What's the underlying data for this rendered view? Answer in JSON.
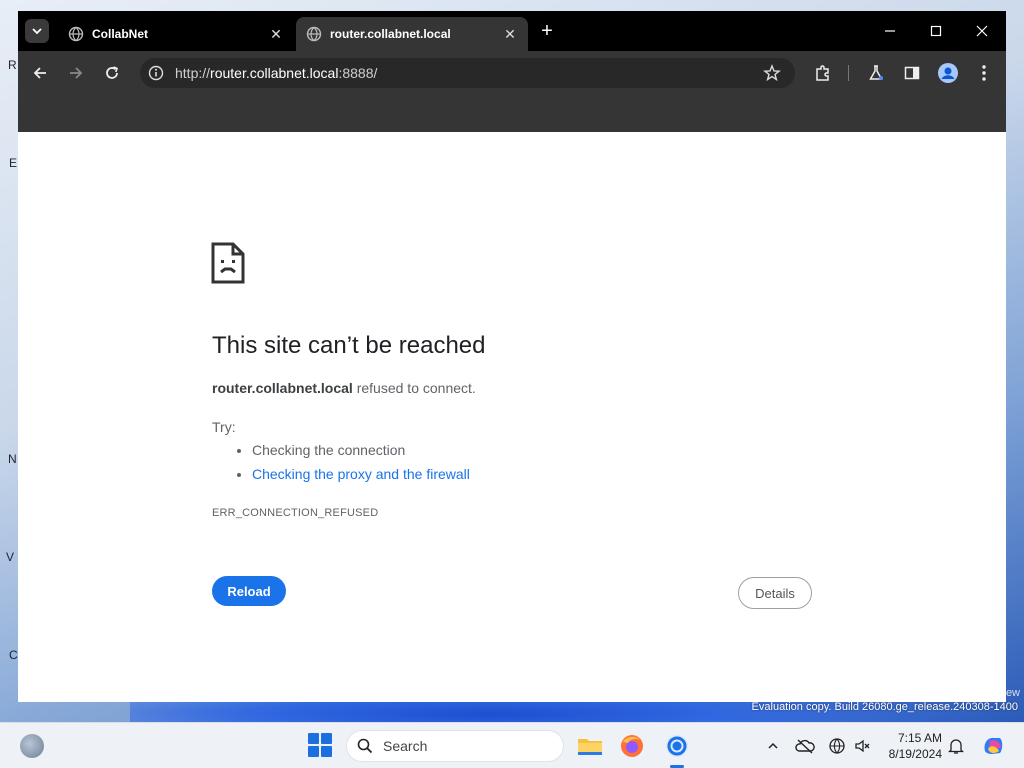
{
  "browser": {
    "tabs": [
      {
        "title": "CollabNet",
        "active": false
      },
      {
        "title": "router.collabnet.local",
        "active": true
      }
    ],
    "address": {
      "scheme": "http://",
      "host": "router.collabnet.local",
      "port_path": ":8888/"
    }
  },
  "error_page": {
    "title": "This site can’t be reached",
    "host": "router.collabnet.local",
    "message": "refused to connect.",
    "try_label": "Try:",
    "suggestions": [
      {
        "text": "Checking the connection",
        "link": false
      },
      {
        "text": "Checking the proxy and the firewall",
        "link": true
      }
    ],
    "error_code": "ERR_CONNECTION_REFUSED",
    "reload_label": "Reload",
    "details_label": "Details"
  },
  "desktop": {
    "watermark": "Evaluation copy. Build 26080.ge_release.240308-1400",
    "watermark_top": "ew"
  },
  "taskbar": {
    "search_placeholder": "Search",
    "time": "7:15 AM",
    "date": "8/19/2024"
  },
  "colors": {
    "accent": "#1a73e8",
    "tab_bar": "#000000",
    "toolbar": "#353535"
  }
}
